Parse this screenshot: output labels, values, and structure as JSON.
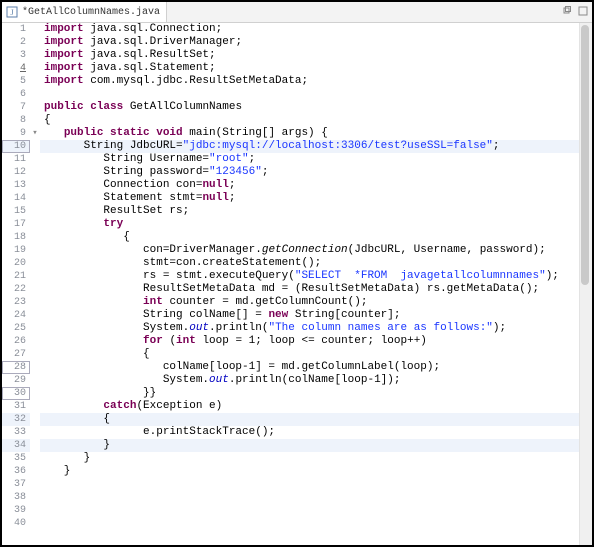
{
  "tab": {
    "title": "*GetAllColumnNames.java"
  },
  "code": {
    "lines": [
      {
        "n": 1,
        "annot": "",
        "hl": false,
        "ul": false,
        "box": false,
        "segs": [
          {
            "t": "import ",
            "c": "kw"
          },
          {
            "t": "java.sql.Connection;",
            "c": "pkg"
          }
        ]
      },
      {
        "n": 2,
        "annot": "",
        "hl": false,
        "ul": false,
        "box": false,
        "segs": [
          {
            "t": "import ",
            "c": "kw"
          },
          {
            "t": "java.sql.DriverManager;",
            "c": "pkg"
          }
        ]
      },
      {
        "n": 3,
        "annot": "",
        "hl": false,
        "ul": false,
        "box": false,
        "segs": [
          {
            "t": "import ",
            "c": "kw"
          },
          {
            "t": "java.sql.ResultSet;",
            "c": "pkg"
          }
        ]
      },
      {
        "n": 4,
        "annot": "",
        "hl": false,
        "ul": true,
        "box": false,
        "segs": [
          {
            "t": "import ",
            "c": "kw"
          },
          {
            "t": "java.sql.Statement;",
            "c": "pkg"
          }
        ]
      },
      {
        "n": 5,
        "annot": "",
        "hl": false,
        "ul": false,
        "box": false,
        "segs": [
          {
            "t": "import ",
            "c": "kw"
          },
          {
            "t": "com.mysql.jdbc.ResultSetMetaData;",
            "c": "pkg"
          }
        ]
      },
      {
        "n": 6,
        "annot": "",
        "hl": false,
        "ul": false,
        "box": false,
        "segs": []
      },
      {
        "n": 7,
        "annot": "",
        "hl": false,
        "ul": false,
        "box": false,
        "segs": [
          {
            "t": "public class ",
            "c": "kw"
          },
          {
            "t": "GetAllColumnNames",
            "c": "cls"
          }
        ]
      },
      {
        "n": 8,
        "annot": "",
        "hl": false,
        "ul": false,
        "box": false,
        "segs": [
          {
            "t": "{",
            "c": ""
          }
        ]
      },
      {
        "n": 9,
        "annot": "▾",
        "hl": false,
        "ul": false,
        "box": false,
        "segs": [
          {
            "t": "   ",
            "c": ""
          },
          {
            "t": "public static void ",
            "c": "kw"
          },
          {
            "t": "main(String[] args) {",
            "c": ""
          }
        ]
      },
      {
        "n": 10,
        "annot": "",
        "hl": true,
        "ul": false,
        "box": true,
        "segs": [
          {
            "t": "      String JdbcURL=",
            "c": ""
          },
          {
            "t": "\"jdbc:mysql://localhost:3",
            "c": "str"
          },
          {
            "t": "3",
            "c": "str"
          },
          {
            "t": "06/test?useSSL=false\"",
            "c": "str"
          },
          {
            "t": ";",
            "c": ""
          }
        ]
      },
      {
        "n": 11,
        "annot": "",
        "hl": false,
        "ul": false,
        "box": false,
        "segs": [
          {
            "t": "         String Username=",
            "c": ""
          },
          {
            "t": "\"root\"",
            "c": "str"
          },
          {
            "t": ";",
            "c": ""
          }
        ]
      },
      {
        "n": 12,
        "annot": "",
        "hl": false,
        "ul": false,
        "box": false,
        "segs": [
          {
            "t": "         String password=",
            "c": ""
          },
          {
            "t": "\"123456\"",
            "c": "str"
          },
          {
            "t": ";",
            "c": ""
          }
        ]
      },
      {
        "n": 13,
        "annot": "",
        "hl": false,
        "ul": false,
        "box": false,
        "segs": [
          {
            "t": "         Connection con=",
            "c": ""
          },
          {
            "t": "null",
            "c": "kw"
          },
          {
            "t": ";",
            "c": ""
          }
        ]
      },
      {
        "n": 14,
        "annot": "",
        "hl": false,
        "ul": false,
        "box": false,
        "segs": [
          {
            "t": "         Statement stmt=",
            "c": ""
          },
          {
            "t": "null",
            "c": "kw"
          },
          {
            "t": ";",
            "c": ""
          }
        ]
      },
      {
        "n": 15,
        "annot": "",
        "hl": false,
        "ul": false,
        "box": false,
        "segs": [
          {
            "t": "         ResultSet rs;",
            "c": ""
          }
        ]
      },
      {
        "n": 17,
        "annot": "",
        "hl": false,
        "ul": false,
        "box": false,
        "segs": [
          {
            "t": "         ",
            "c": ""
          },
          {
            "t": "try",
            "c": "kw"
          }
        ]
      },
      {
        "n": 18,
        "annot": "",
        "hl": false,
        "ul": false,
        "box": false,
        "segs": [
          {
            "t": "            {",
            "c": ""
          }
        ]
      },
      {
        "n": 19,
        "annot": "",
        "hl": false,
        "ul": false,
        "box": false,
        "segs": [
          {
            "t": "               con=DriverManager.",
            "c": ""
          },
          {
            "t": "getConnection",
            "c": "mth"
          },
          {
            "t": "(JdbcURL, Username, password);",
            "c": ""
          }
        ]
      },
      {
        "n": 20,
        "annot": "",
        "hl": false,
        "ul": false,
        "box": false,
        "segs": [
          {
            "t": "               stmt=con.createStatement();",
            "c": ""
          }
        ]
      },
      {
        "n": 21,
        "annot": "",
        "hl": false,
        "ul": false,
        "box": false,
        "segs": [
          {
            "t": "               rs = stmt.executeQuery(",
            "c": ""
          },
          {
            "t": "\"SELECT  *FROM  javagetallcolumnnames\"",
            "c": "str"
          },
          {
            "t": ");",
            "c": ""
          }
        ]
      },
      {
        "n": 22,
        "annot": "",
        "hl": false,
        "ul": false,
        "box": false,
        "segs": [
          {
            "t": "               ResultSetMetaData md = (ResultSetMetaData) rs.getMetaData();",
            "c": ""
          }
        ]
      },
      {
        "n": 23,
        "annot": "",
        "hl": false,
        "ul": false,
        "box": false,
        "segs": [
          {
            "t": "               ",
            "c": ""
          },
          {
            "t": "int",
            "c": "kw"
          },
          {
            "t": " counter = md.getColumnCount();",
            "c": ""
          }
        ]
      },
      {
        "n": 24,
        "annot": "",
        "hl": false,
        "ul": false,
        "box": false,
        "segs": [
          {
            "t": "               String colName[] = ",
            "c": ""
          },
          {
            "t": "new",
            "c": "kw"
          },
          {
            "t": " String[counter];",
            "c": ""
          }
        ]
      },
      {
        "n": 25,
        "annot": "",
        "hl": false,
        "ul": false,
        "box": false,
        "segs": [
          {
            "t": "               System.",
            "c": ""
          },
          {
            "t": "out",
            "c": "sfld"
          },
          {
            "t": ".println(",
            "c": ""
          },
          {
            "t": "\"The column names are as follows:\"",
            "c": "str"
          },
          {
            "t": ");",
            "c": ""
          }
        ]
      },
      {
        "n": 26,
        "annot": "",
        "hl": false,
        "ul": false,
        "box": false,
        "segs": [
          {
            "t": "               ",
            "c": ""
          },
          {
            "t": "for",
            "c": "kw"
          },
          {
            "t": " (",
            "c": ""
          },
          {
            "t": "int",
            "c": "kw"
          },
          {
            "t": " loop = 1; loop <= counter; loop++)",
            "c": ""
          }
        ]
      },
      {
        "n": 27,
        "annot": "",
        "hl": false,
        "ul": false,
        "box": false,
        "segs": [
          {
            "t": "               {",
            "c": ""
          }
        ]
      },
      {
        "n": 28,
        "annot": "",
        "hl": false,
        "ul": false,
        "box": true,
        "segs": [
          {
            "t": "                  colName[loop-1] = md.getColumnLabel(loop);",
            "c": ""
          }
        ]
      },
      {
        "n": 29,
        "annot": "",
        "hl": false,
        "ul": false,
        "box": false,
        "segs": [
          {
            "t": "                  System.",
            "c": ""
          },
          {
            "t": "out",
            "c": "sfld"
          },
          {
            "t": ".println(colName[loop-1]);",
            "c": ""
          }
        ]
      },
      {
        "n": 30,
        "annot": "",
        "hl": false,
        "ul": false,
        "box": true,
        "segs": [
          {
            "t": "               }}",
            "c": ""
          }
        ]
      },
      {
        "n": 31,
        "annot": "",
        "hl": false,
        "ul": false,
        "box": false,
        "segs": [
          {
            "t": "         ",
            "c": ""
          },
          {
            "t": "catch",
            "c": "kw"
          },
          {
            "t": "(Exception e)",
            "c": ""
          }
        ]
      },
      {
        "n": 32,
        "annot": "",
        "hl": true,
        "ul": false,
        "box": false,
        "segs": [
          {
            "t": "         {",
            "c": ""
          }
        ]
      },
      {
        "n": 33,
        "annot": "",
        "hl": false,
        "ul": false,
        "box": false,
        "segs": [
          {
            "t": "               e.printStackTrace();",
            "c": ""
          }
        ]
      },
      {
        "n": 34,
        "annot": "",
        "hl": true,
        "ul": false,
        "box": false,
        "segs": [
          {
            "t": "         }",
            "c": ""
          }
        ]
      },
      {
        "n": 35,
        "annot": "",
        "hl": false,
        "ul": false,
        "box": false,
        "segs": [
          {
            "t": "      }",
            "c": ""
          }
        ]
      },
      {
        "n": 36,
        "annot": "",
        "hl": false,
        "ul": false,
        "box": false,
        "segs": [
          {
            "t": "   }",
            "c": ""
          }
        ]
      },
      {
        "n": 37,
        "annot": "",
        "hl": false,
        "ul": false,
        "box": false,
        "segs": []
      },
      {
        "n": 38,
        "annot": "",
        "hl": false,
        "ul": false,
        "box": false,
        "segs": []
      },
      {
        "n": 39,
        "annot": "",
        "hl": false,
        "ul": false,
        "box": false,
        "segs": []
      },
      {
        "n": 40,
        "annot": "",
        "hl": false,
        "ul": false,
        "box": false,
        "segs": []
      }
    ]
  }
}
